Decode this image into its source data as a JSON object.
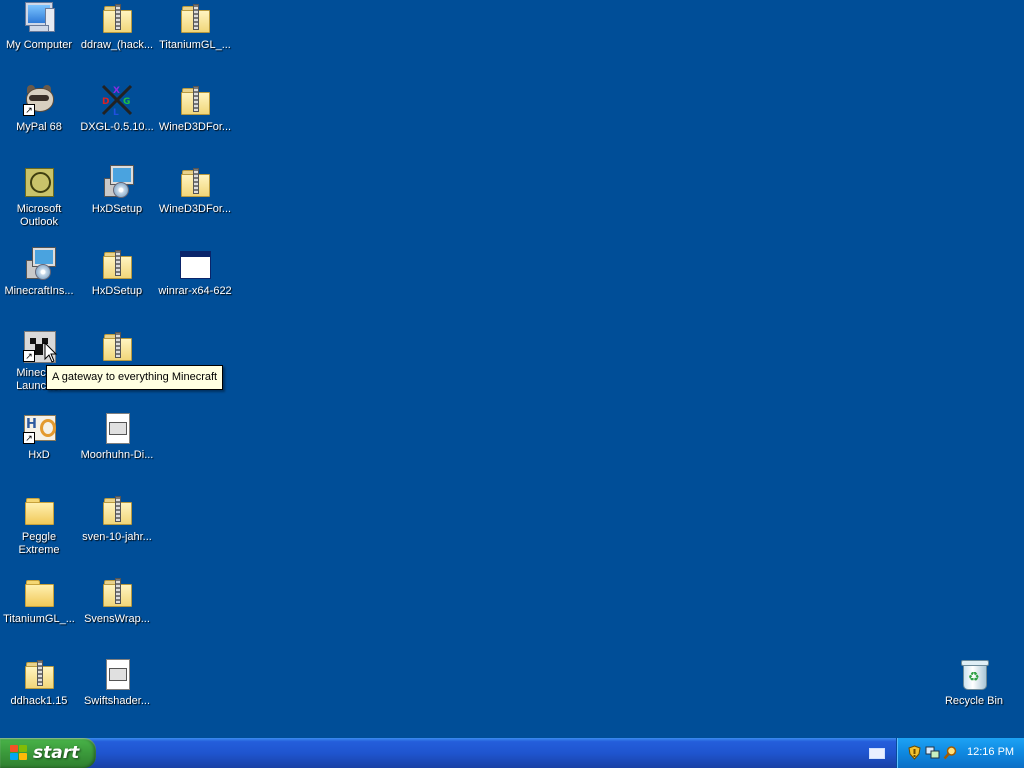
{
  "desktop": {
    "background": "#004e98",
    "icons": {
      "my_computer": "My Computer",
      "ddraw": "ddraw_(hack...",
      "titaniumgl1": "TitaniumGL_...",
      "mypal": "MyPal 68",
      "dxgl": "DXGL-0.5.10...",
      "wined3d1": "WineD3DFor...",
      "outlook": "Microsoft Outlook",
      "hxdsetup_exe": "HxDSetup",
      "wined3d2": "WineD3DFor...",
      "minecraftins": "MinecraftIns...",
      "hxdsetup_zip": "HxDSetup",
      "winrar": "winrar-x64-622",
      "minecraft_launcher": "Minecraft Launcher",
      "hxd": "HxD",
      "moorhuhn": "Moorhuhn-Di...",
      "peggle": "Peggle Extreme",
      "sven": "sven-10-jahr...",
      "titaniumgl2": "TitaniumGL_...",
      "svenswrap": "SvensWrap...",
      "ddhack": "ddhack1.15",
      "swiftshader": "Swiftshader...",
      "recycle_bin": "Recycle Bin"
    },
    "tooltip": "A gateway to everything Minecraft"
  },
  "taskbar": {
    "start_label": "start",
    "clock": "12:16 PM"
  }
}
